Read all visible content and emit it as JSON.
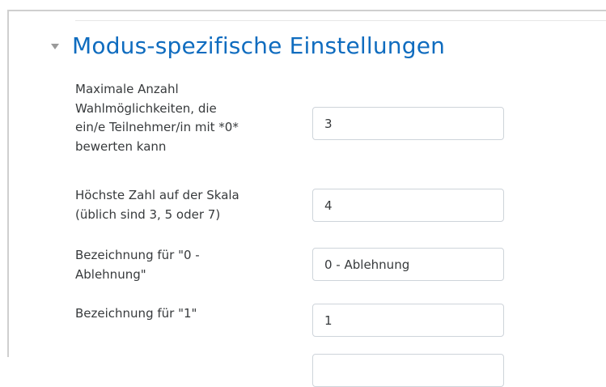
{
  "section": {
    "title": "Modus-spezifische Einstellungen"
  },
  "fields": [
    {
      "label_lines": [
        "Maximale Anzahl",
        "Wahlmöglichkeiten, die",
        "ein/e Teilnehmer/in mit *0*",
        "bewerten kann"
      ],
      "value": "3"
    },
    {
      "label_lines": [
        "Höchste Zahl auf der Skala",
        "(üblich sind 3, 5 oder 7)"
      ],
      "value": "4"
    },
    {
      "label_lines": [
        "Bezeichnung für \"0 -",
        "Ablehnung\""
      ],
      "value": "0 - Ablehnung"
    },
    {
      "label_lines": [
        "Bezeichnung für \"1\""
      ],
      "value": "1"
    },
    {
      "label_lines": [],
      "value": ""
    }
  ]
}
